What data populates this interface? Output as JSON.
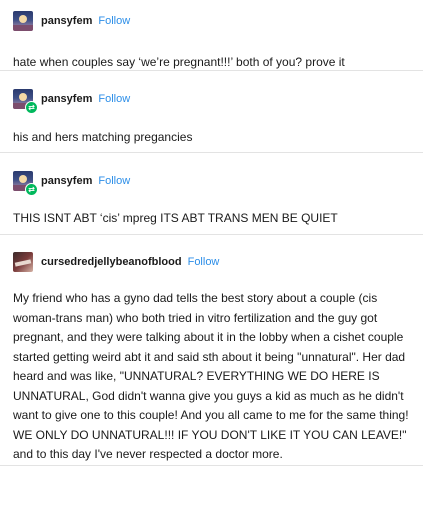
{
  "posts": [
    {
      "username": "pansyfem",
      "follow_label": "Follow",
      "avatar_icon": "sunset-avatar",
      "has_badge": false,
      "body": "hate when couples say ‘we’re pregnant!!!’ both of you? prove it"
    },
    {
      "username": "pansyfem",
      "follow_label": "Follow",
      "avatar_icon": "sunset-avatar",
      "has_badge": true,
      "badge_icon": "reblog-icon",
      "body": "his and hers matching pregancies"
    },
    {
      "username": "pansyfem",
      "follow_label": "Follow",
      "avatar_icon": "sunset-avatar",
      "has_badge": true,
      "badge_icon": "reblog-icon",
      "body": "THIS ISNT ABT ‘cis’ mpreg ITS ABT TRANS MEN BE QUIET"
    },
    {
      "username": "cursedredjellybeanofblood",
      "follow_label": "Follow",
      "avatar_icon": "photo-avatar",
      "has_badge": false,
      "body": "My friend who has a gyno dad tells the best story about a couple (cis woman-trans man) who both tried in vitro fertilization and the guy got pregnant, and they were talking about it in the lobby when a cishet couple started getting weird abt it and said sth about it being \"unnatural\". Her dad heard and was like, \"UNNATURAL? EVERYTHING WE DO HERE IS UNNATURAL, God didn't wanna give you guys a kid as much as he didn't want to give one to this couple! And you all came to me for the same thing! WE ONLY DO UNNATURAL!!! IF YOU DON'T LIKE IT YOU CAN LEAVE!\" and to this day I've never respected a doctor more."
    }
  ],
  "colors": {
    "follow": "#2c8ee8",
    "badge": "#00b85c",
    "divider": "#e3e3e3"
  }
}
